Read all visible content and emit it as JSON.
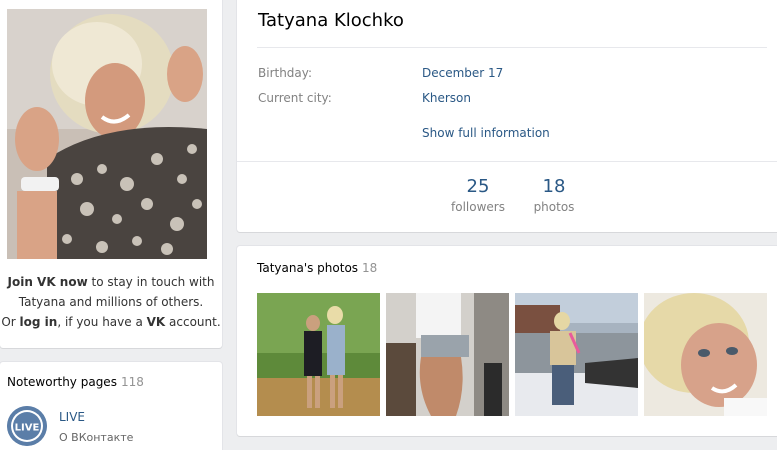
{
  "profile": {
    "name": "Tatyana Klochko",
    "info": [
      {
        "label": "Birthday:",
        "value": "December 17"
      },
      {
        "label": "Current city:",
        "value": "Kherson"
      }
    ],
    "show_full": "Show full information",
    "counters": {
      "followers": {
        "value": "25",
        "label": "followers"
      },
      "photos": {
        "value": "18",
        "label": "photos"
      }
    }
  },
  "join": {
    "bold1": "Join VK now",
    "text1": " to stay in touch with",
    "text2": "Tatyana and millions of others.",
    "text3a": "Or ",
    "login": "log in",
    "text3b": ", if you have a ",
    "vk": "VK",
    "text3c": " account."
  },
  "noteworthy": {
    "title": "Noteworthy pages",
    "count": "118",
    "items": [
      {
        "name": "LIVE",
        "subtitle": "О ВКонтакте",
        "logo_text": "LIVE"
      }
    ]
  },
  "photos": {
    "title": "Tatyana's photos",
    "count": "18",
    "thumbnails": [
      "photo-park",
      "photo-gym",
      "photo-street",
      "photo-portrait"
    ]
  },
  "colors": {
    "link": "#2a5885",
    "background": "#edeef0",
    "muted": "#828282"
  }
}
